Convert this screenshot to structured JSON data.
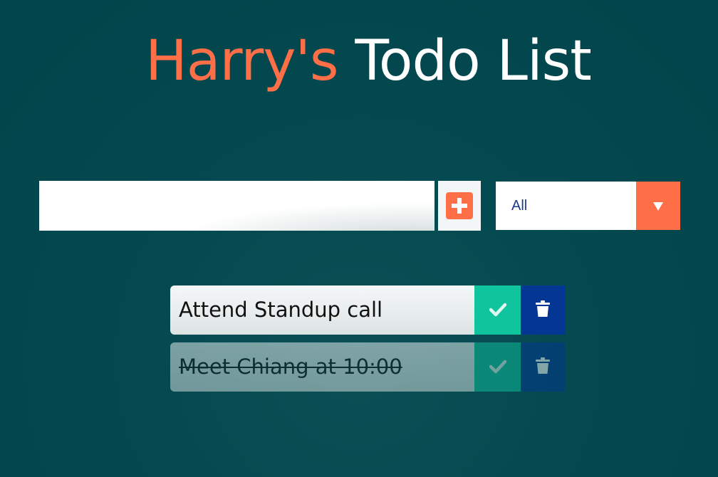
{
  "header": {
    "owner": "Harry's",
    "title_rest": "Todo List"
  },
  "form": {
    "input_value": "",
    "add_icon": "plus-square-icon",
    "filter": {
      "selected": "All",
      "icon": "caret-down-icon"
    }
  },
  "todos": [
    {
      "text": "Attend Standup call",
      "completed": false
    },
    {
      "text": "Meet Chiang at 10:00",
      "completed": true
    }
  ],
  "colors": {
    "accent": "#ff6f47",
    "complete": "#10c59e",
    "trash": "#043694",
    "background": "#02444b"
  }
}
